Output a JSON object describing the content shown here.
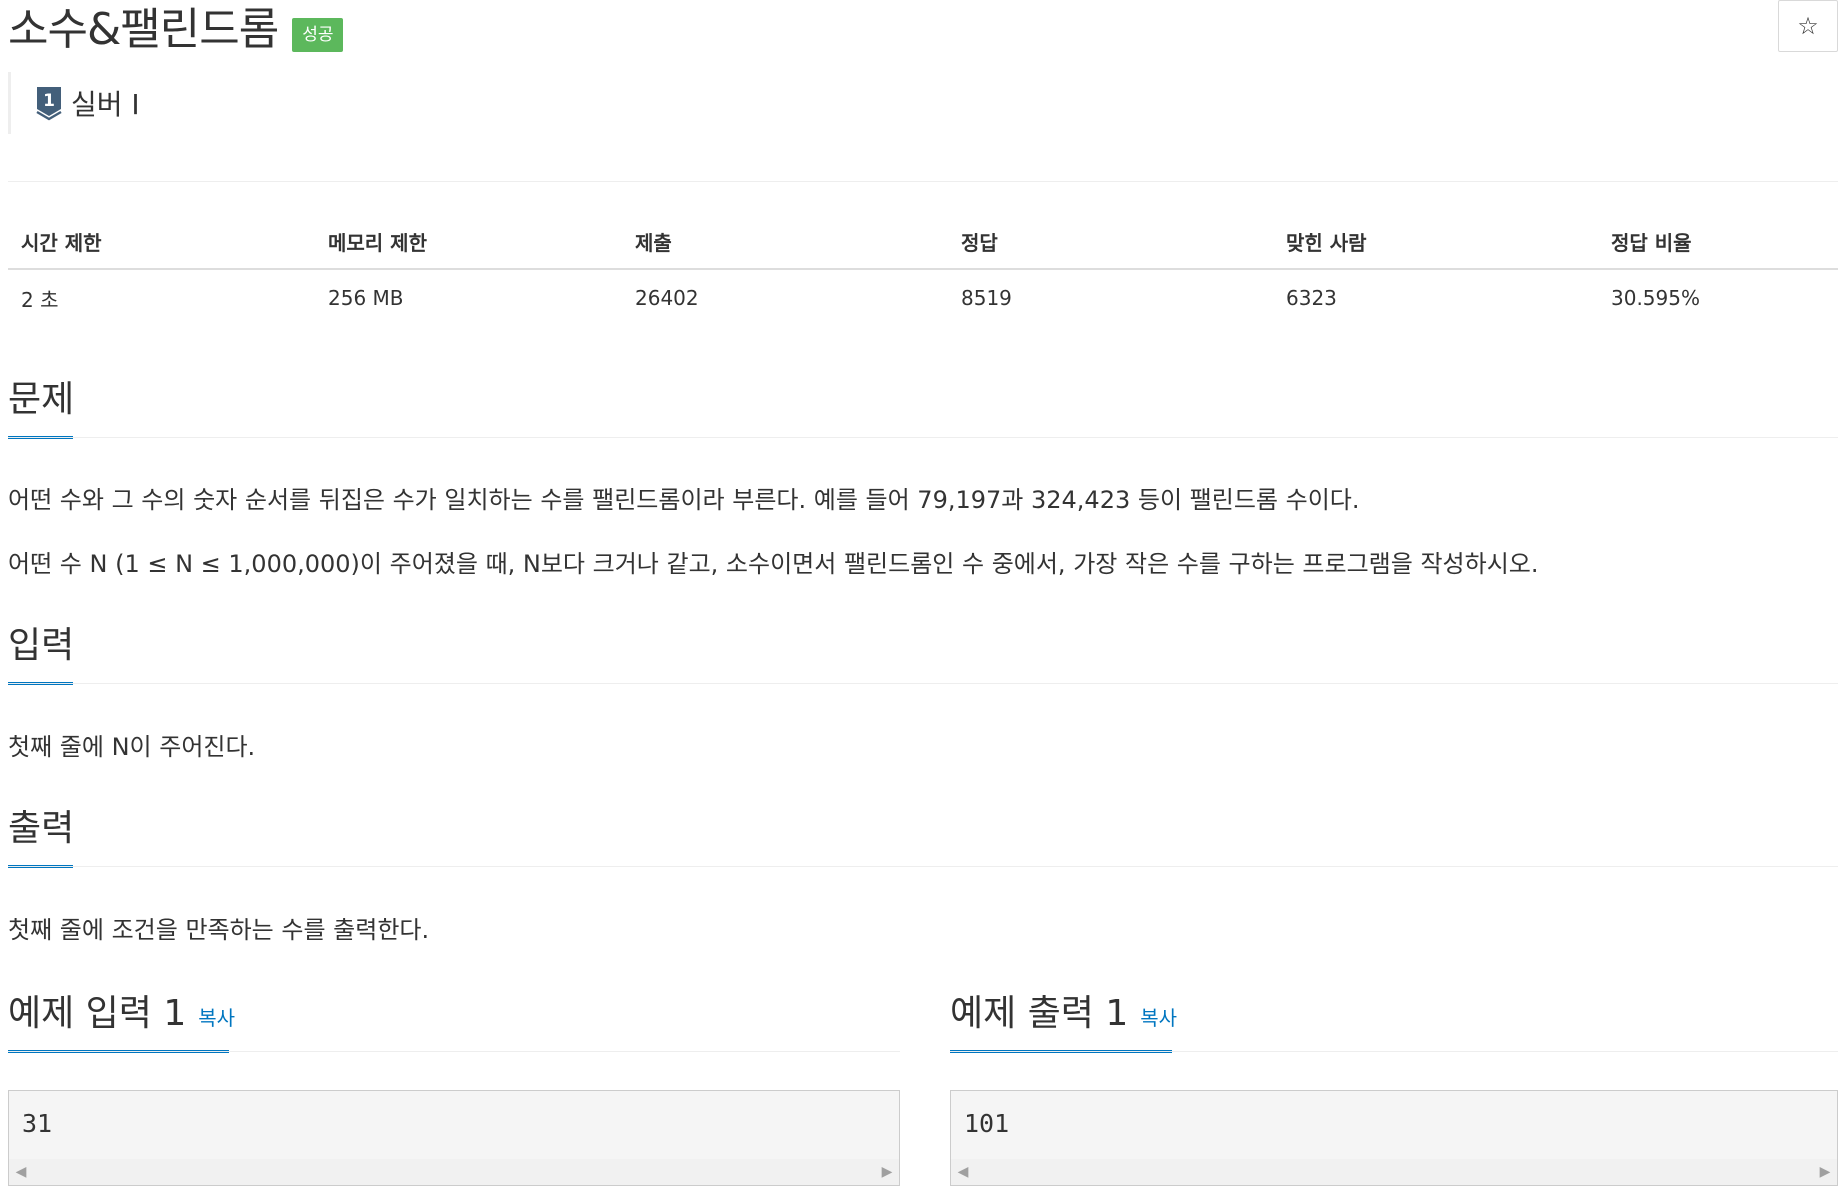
{
  "problem": {
    "title": "소수&팰린드롬",
    "status_badge": "성공",
    "star_icon": "☆",
    "tier": {
      "number": "1",
      "label": "실버 I"
    }
  },
  "info": {
    "headers": [
      "시간 제한",
      "메모리 제한",
      "제출",
      "정답",
      "맞힌 사람",
      "정답 비율"
    ],
    "values": [
      "2 초",
      "256 MB",
      "26402",
      "8519",
      "6323",
      "30.595%"
    ]
  },
  "sections": {
    "problem": {
      "heading": "문제",
      "paragraphs": [
        "어떤 수와 그 수의 숫자 순서를 뒤집은 수가 일치하는 수를 팰린드롬이라 부른다. 예를 들어 79,197과 324,423 등이 팰린드롬 수이다.",
        "어떤 수 N (1 ≤ N ≤ 1,000,000)이 주어졌을 때, N보다 크거나 같고, 소수이면서 팰린드롬인 수 중에서, 가장 작은 수를 구하는 프로그램을 작성하시오."
      ]
    },
    "input": {
      "heading": "입력",
      "text": "첫째 줄에 N이 주어진다."
    },
    "output": {
      "heading": "출력",
      "text": "첫째 줄에 조건을 만족하는 수를 출력한다."
    }
  },
  "samples": {
    "input": {
      "title": "예제 입력 1",
      "copy": "복사",
      "value": "31"
    },
    "output": {
      "title": "예제 출력 1",
      "copy": "복사",
      "value": "101"
    }
  },
  "colors": {
    "accent": "#0076c0",
    "success": "#5cb85c"
  }
}
